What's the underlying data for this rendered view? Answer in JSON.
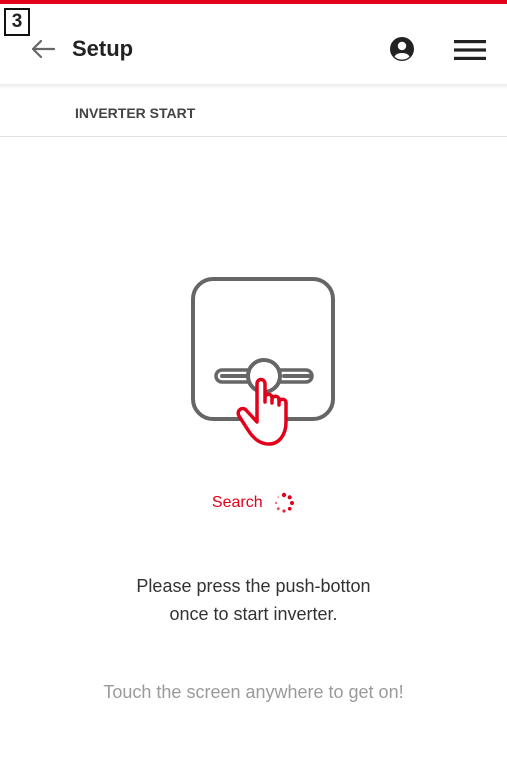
{
  "step_badge": "3",
  "appbar": {
    "title": "Setup",
    "icons": [
      "back-arrow-icon",
      "user-icon",
      "menu-icon"
    ]
  },
  "subheader": {
    "label": "INVERTER START"
  },
  "illustration": {
    "icon": "push-button-hand-icon"
  },
  "search": {
    "label": "Search",
    "icon": "spinner-icon"
  },
  "instruction": {
    "line1": "Please press the push-botton",
    "line2": "once to start inverter."
  },
  "hint": "Touch the screen anywhere to get on!",
  "colors": {
    "accent": "#e2001a",
    "text": "#222222",
    "hint": "#9a9a9a",
    "icon_gray": "#666666"
  }
}
